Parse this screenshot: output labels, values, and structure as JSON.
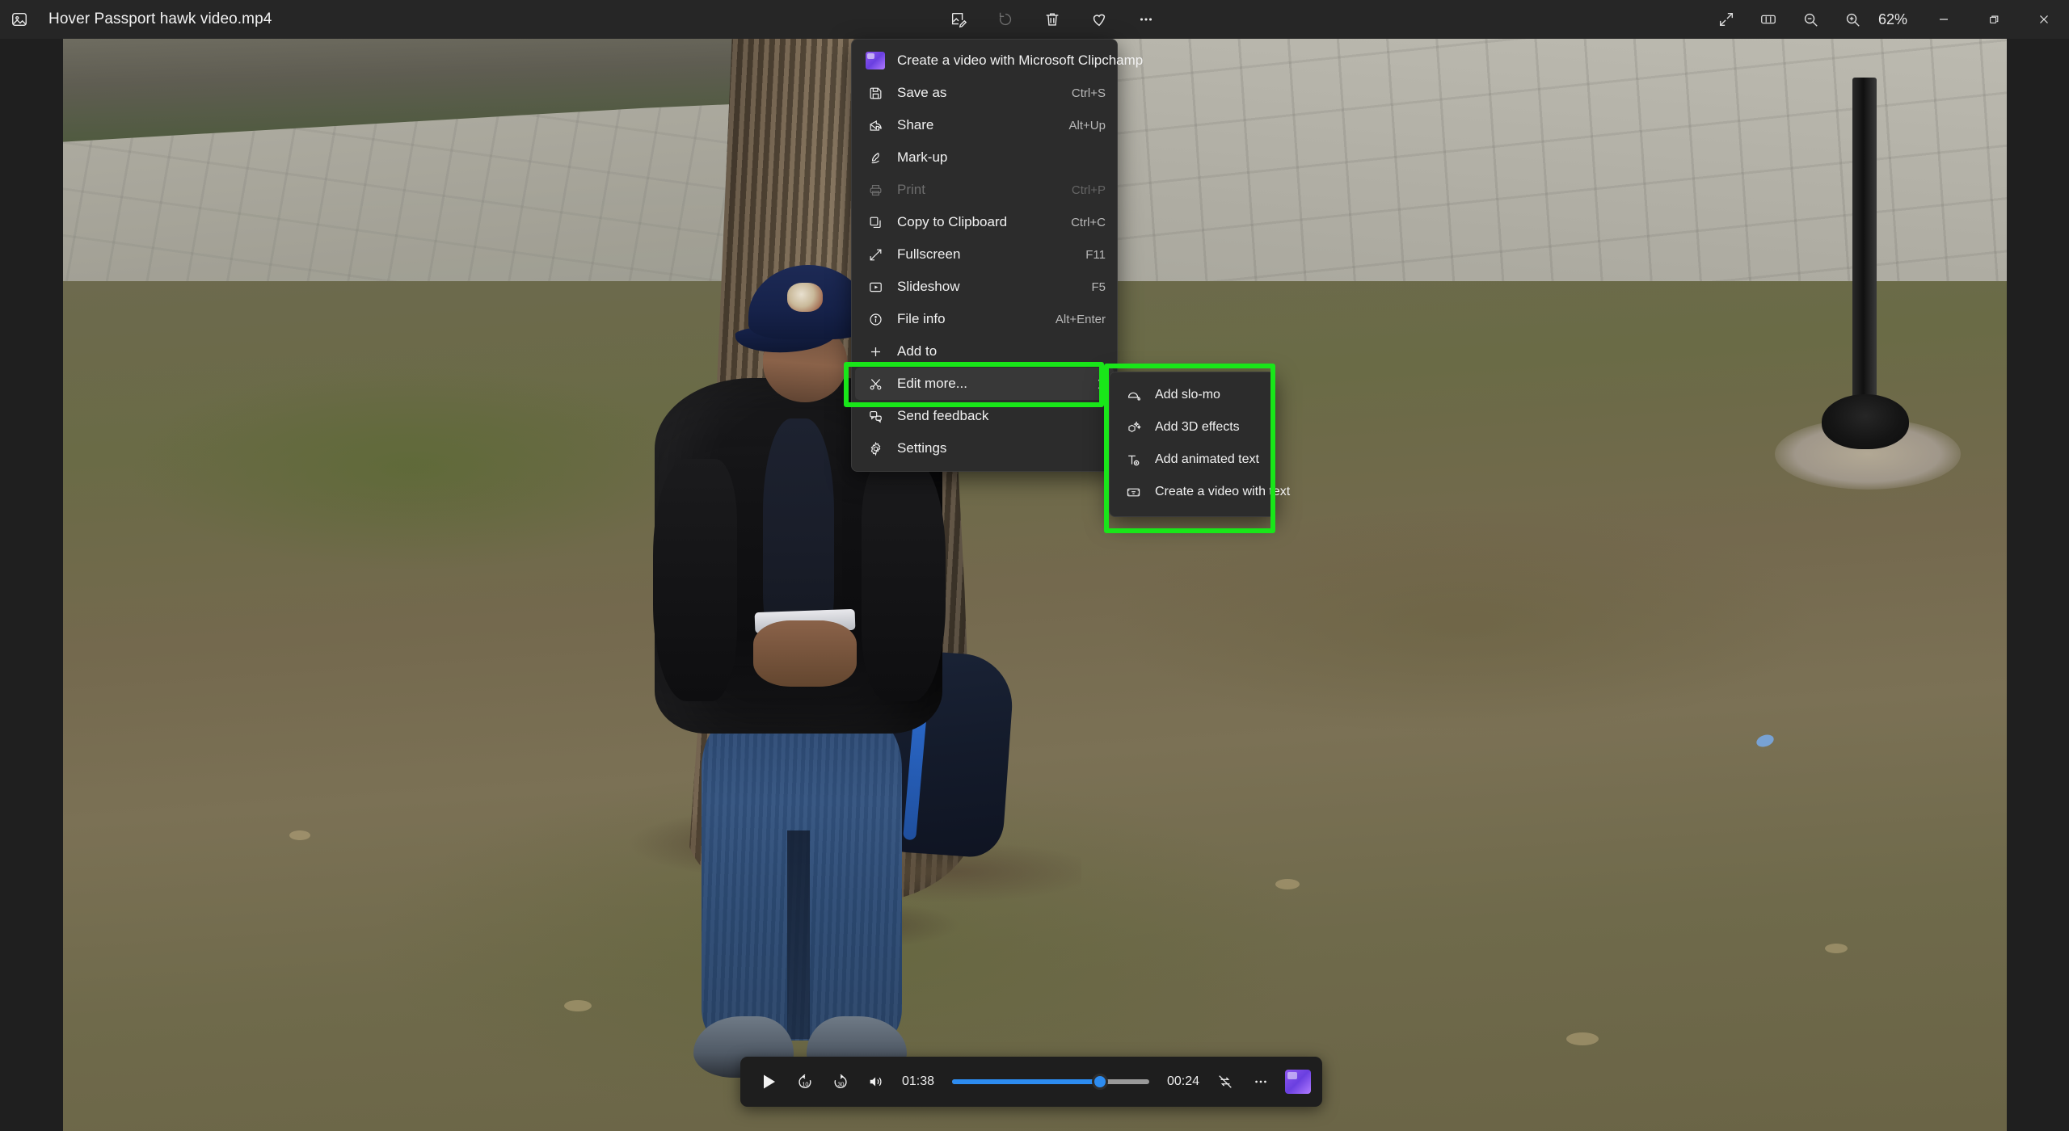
{
  "window": {
    "app_icon": "photos-app-icon",
    "title": "Hover Passport hawk video.mp4",
    "zoom_level": "62%",
    "toolbar": [
      {
        "name": "edit-image-button",
        "icon": "edit-image-icon",
        "enabled": true
      },
      {
        "name": "rotate-button",
        "icon": "rotate-icon",
        "enabled": false
      },
      {
        "name": "delete-button",
        "icon": "trash-icon",
        "enabled": true
      },
      {
        "name": "favorite-button",
        "icon": "heart-icon",
        "enabled": true
      },
      {
        "name": "more-options-button",
        "icon": "ellipsis-icon",
        "enabled": true
      }
    ],
    "view_controls": [
      {
        "name": "fit-to-window-button",
        "icon": "arrows-diagonal-icon"
      },
      {
        "name": "filmstrip-button",
        "icon": "filmstrip-icon"
      },
      {
        "name": "zoom-out-button",
        "icon": "magnifier-minus-icon"
      },
      {
        "name": "zoom-in-button",
        "icon": "magnifier-plus-icon"
      }
    ],
    "caption_buttons": [
      {
        "name": "minimize-button",
        "icon": "minimize-icon"
      },
      {
        "name": "maximize-button",
        "icon": "restore-icon"
      },
      {
        "name": "close-button",
        "icon": "close-icon"
      }
    ]
  },
  "context_menu": {
    "items": [
      {
        "label": "Create a video with Microsoft Clipchamp",
        "accel": "",
        "icon": "clipchamp-icon",
        "disabled": false,
        "selected": false,
        "submenu": false
      },
      {
        "label": "Save as",
        "accel": "Ctrl+S",
        "icon": "save-icon",
        "disabled": false,
        "selected": false,
        "submenu": false
      },
      {
        "label": "Share",
        "accel": "Alt+Up",
        "icon": "share-icon",
        "disabled": false,
        "selected": false,
        "submenu": false
      },
      {
        "label": "Mark-up",
        "accel": "",
        "icon": "pen-icon",
        "disabled": false,
        "selected": false,
        "submenu": false
      },
      {
        "label": "Print",
        "accel": "Ctrl+P",
        "icon": "printer-icon",
        "disabled": true,
        "selected": false,
        "submenu": false
      },
      {
        "label": "Copy to Clipboard",
        "accel": "Ctrl+C",
        "icon": "copy-icon",
        "disabled": false,
        "selected": false,
        "submenu": false
      },
      {
        "label": "Fullscreen",
        "accel": "F11",
        "icon": "fullscreen-icon",
        "disabled": false,
        "selected": false,
        "submenu": false
      },
      {
        "label": "Slideshow",
        "accel": "F5",
        "icon": "slideshow-icon",
        "disabled": false,
        "selected": false,
        "submenu": false
      },
      {
        "label": "File info",
        "accel": "Alt+Enter",
        "icon": "info-icon",
        "disabled": false,
        "selected": false,
        "submenu": false
      },
      {
        "label": "Add to",
        "accel": "",
        "icon": "plus-icon",
        "disabled": false,
        "selected": false,
        "submenu": false
      },
      {
        "label": "Edit more...",
        "accel": "",
        "icon": "scissors-icon",
        "disabled": false,
        "selected": true,
        "submenu": true
      },
      {
        "label": "Send feedback",
        "accel": "",
        "icon": "feedback-icon",
        "disabled": false,
        "selected": false,
        "submenu": false
      },
      {
        "label": "Settings",
        "accel": "",
        "icon": "gear-icon",
        "disabled": false,
        "selected": false,
        "submenu": false
      }
    ]
  },
  "submenu": {
    "items": [
      {
        "label": "Add slo-mo",
        "icon": "slo-mo-icon"
      },
      {
        "label": "Add 3D effects",
        "icon": "3d-effects-icon"
      },
      {
        "label": "Add animated text",
        "icon": "animated-text-icon"
      },
      {
        "label": "Create a video with text",
        "icon": "video-with-text-icon"
      }
    ]
  },
  "highlights": {
    "color": "#19e619",
    "boxes": [
      "edit-more-menu-item",
      "edit-more-submenu"
    ]
  },
  "player": {
    "play_label": "play-icon",
    "rewind_label": "10",
    "forward_label": "30",
    "volume_label": "volume-icon",
    "current_time": "01:38",
    "remaining_time": "00:24",
    "progress_percent": 75,
    "loop_label": "loop-off-icon",
    "more_label": "ellipsis-icon",
    "clipchamp_label": "clipchamp-icon",
    "accent_color": "#2d8cf0"
  }
}
